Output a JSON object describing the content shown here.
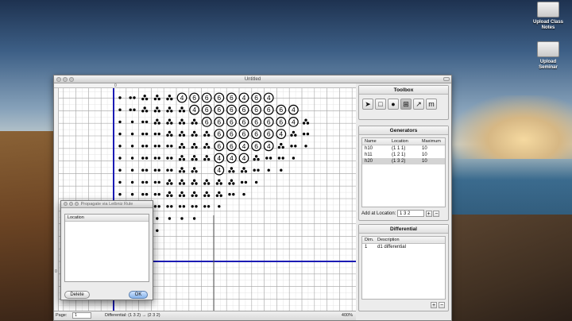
{
  "desktop": {
    "icons": [
      {
        "name": "upload-class-notes",
        "label_lines": [
          "Upload Class",
          "Notes"
        ]
      },
      {
        "name": "upload-seminar",
        "label_lines": [
          "Upload",
          "Seminar"
        ]
      }
    ]
  },
  "window": {
    "title": "Untitled",
    "ruler_origin_x": "0",
    "ruler_origin_y": "0",
    "status": {
      "page_label": "Page:",
      "page_value": "1",
      "message": "Differential: (1 3 2) → (2 3 2)",
      "zoom": "400%"
    }
  },
  "toolbox": {
    "title": "Toolbox",
    "tools": [
      {
        "name": "arrow-tool-icon",
        "glyph": "➤",
        "active": false
      },
      {
        "name": "rectangle-tool-icon",
        "glyph": "□",
        "active": false
      },
      {
        "name": "circle-tool-icon",
        "glyph": "●",
        "active": false
      },
      {
        "name": "grid-select-tool-icon",
        "glyph": "⊞",
        "active": true
      },
      {
        "name": "differential-tool-icon",
        "glyph": "↗",
        "active": false
      },
      {
        "name": "m-tool-icon",
        "glyph": "m",
        "active": false
      }
    ]
  },
  "generators": {
    "title": "Generators",
    "columns": [
      "Name",
      "Location",
      "Maximum"
    ],
    "rows": [
      {
        "name": "h10",
        "location": "(1 1 1)",
        "maximum": "10",
        "selected": false
      },
      {
        "name": "h11",
        "location": "(1 2 1)",
        "maximum": "10",
        "selected": false
      },
      {
        "name": "h20",
        "location": "(1 3 2)",
        "maximum": "10",
        "selected": true
      }
    ],
    "add_label": "Add at Location:",
    "add_value": "1 3 2",
    "plus": "+",
    "minus": "−"
  },
  "differential": {
    "title": "Differential",
    "columns": [
      "Dim.",
      "Description"
    ],
    "rows": [
      {
        "dim": "1",
        "description": "d1 differential"
      }
    ],
    "plus": "+",
    "minus": "−"
  },
  "dialog": {
    "title": "Propagate via Leibniz Rule",
    "column": "Location",
    "delete_label": "Delete",
    "ok_label": "OK"
  },
  "chart_grid": {
    "circled_number_counts": [
      {
        "row": 0,
        "labels": [
          "4",
          "6",
          "6",
          "6",
          "6",
          "4",
          "6",
          "4"
        ]
      },
      {
        "row": 1,
        "labels": [
          "4",
          "6",
          "6",
          "6",
          "6",
          "6",
          "6",
          "6",
          "4"
        ]
      },
      {
        "row": 2,
        "labels": [
          "6",
          "6",
          "6",
          "6",
          "6",
          "6",
          "6",
          "4"
        ]
      },
      {
        "row": 3,
        "labels": [
          "6",
          "6",
          "6",
          "6",
          "6",
          "4"
        ]
      },
      {
        "row": 4,
        "labels": [
          "6",
          "6",
          "4",
          "6",
          "4"
        ]
      },
      {
        "row": 5,
        "labels": [
          "4",
          "4",
          "4"
        ]
      },
      {
        "row": 6,
        "labels": [
          "4"
        ]
      }
    ],
    "glyph_colors": {
      "grid_major": "#a8a8a8",
      "grid_minor": "#e4e4e4",
      "axis": "#1b1bb4",
      "dot": "#000000"
    }
  }
}
